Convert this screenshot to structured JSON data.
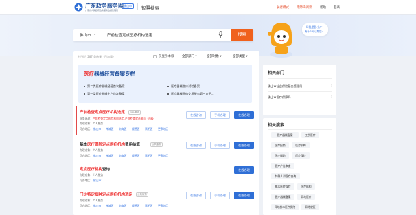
{
  "header": {
    "site_name": "广东政务服务网",
    "site_subtitle": "广东省人民政府政务服务数据管理局",
    "region_tag": "佛山市",
    "brand": "智慧搜索",
    "links": [
      {
        "label": "长者模式",
        "color": "#e5502f"
      },
      {
        "label": "无障碍阅读",
        "color": "#e5502f"
      },
      {
        "label": "帮助",
        "color": "#333333"
      },
      {
        "label": "登录",
        "color": "#333333"
      }
    ]
  },
  "search": {
    "city": "佛山市",
    "query": "产前检查定点医疗机构选定",
    "button": "搜索"
  },
  "assistant": {
    "title": "Hi 我是智小广",
    "subtitle": "有什么可以帮您~"
  },
  "results_bar": {
    "count_text": "找到约 287 条结果（已加载）",
    "checkbox_label": "仅显示本级",
    "filters": [
      "全部部门",
      "全部对象",
      "全部类型"
    ]
  },
  "banner": {
    "title_highlight": "医疗",
    "title_rest": "器械经营备案专栏",
    "links": [
      "第二类医疗器械经营首次备案",
      "第一类医疗器械生产首次备案",
      "医疗器械临床试验备案",
      "医疗器械网络交易服务第三方平..."
    ]
  },
  "results": [
    {
      "title_parts": [
        "产前检查定点医疗机构选定"
      ],
      "title_hl": [
        true
      ],
      "tag": "公共服务",
      "row1_label": "业务办理：",
      "row1_value": "产前检查定点医疗机构选定-产前检查就选佛山（市级）",
      "row2_label": "办理对象：",
      "row2_value": "个人服务",
      "row3_label": "可办地区：",
      "regions": [
        "佛山市",
        "禅城区",
        "南海区",
        "顺德区",
        "高明区",
        "更多地区"
      ],
      "buttons": [
        "在线咨询",
        "手机办理",
        "在线办理"
      ]
    },
    {
      "title_parts": [
        "基本",
        "医疗保险定点医疗机构",
        "费用结算"
      ],
      "title_hl": [
        false,
        true,
        false
      ],
      "tag": "公共服务",
      "row2_label": "办理对象：",
      "row2_value": "个人服务",
      "row3_label": "可办地区：",
      "regions": [
        "佛山市",
        "禅城区",
        "南海区",
        "顺德区",
        "高明区",
        "更多地区"
      ],
      "buttons": [
        "在线咨询",
        "手机办理",
        "在线办理"
      ]
    },
    {
      "title_parts": [
        "定点医疗机构",
        "查询"
      ],
      "title_hl": [
        true,
        false
      ],
      "row2_label": "办理对象：",
      "row2_value": "个人服务",
      "row3_label": "可办地区：",
      "regions": [
        "佛山市"
      ],
      "buttons": [
        "在线办理"
      ]
    },
    {
      "title_parts": [
        "门诊特定病种",
        "定点医疗机构选定"
      ],
      "title_hl": [
        false,
        true
      ],
      "tag": "公共服务",
      "row2_label": "办理对象：",
      "row2_value": "个人服务",
      "row3_label": "可办地区：",
      "regions": [
        "佛山市",
        "禅城区",
        "南海区",
        "顺德区",
        "高明区",
        "更多地区"
      ],
      "buttons": [
        "在线咨询",
        "手机办理",
        "在线办理"
      ]
    }
  ],
  "sidebar": {
    "depts_title": "相关部门",
    "depts": [
      "佛山市社会保险基金管理局",
      "佛山市医疗保障局"
    ],
    "search_title": "相关搜索",
    "search_tags": [
      [
        "医疗器械备案",
        "工伤医疗"
      ],
      [
        "医疗报销",
        "医疗机构"
      ],
      [
        "医疗辅助",
        "医疗保险"
      ],
      [
        "医疗广告审查"
      ],
      [
        "特殊人群医疗查询"
      ],
      [
        "基本医疗保险",
        "医疗机构"
      ],
      [
        "医疗器械备案",
        "异地医疗"
      ],
      [
        "异地基本医疗保险",
        "异地就医"
      ]
    ]
  }
}
